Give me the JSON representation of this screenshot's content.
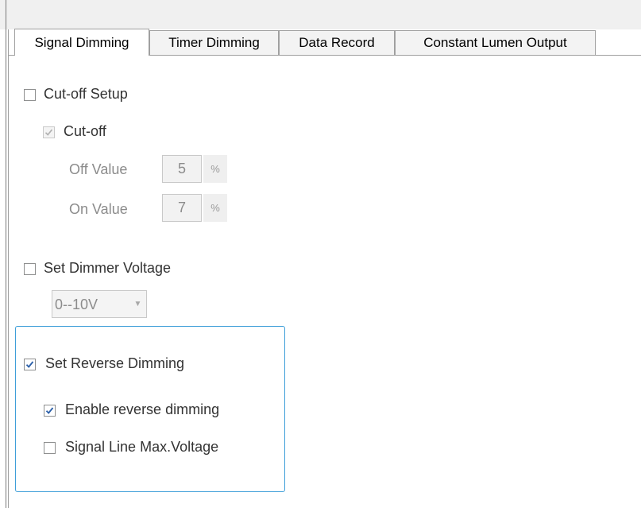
{
  "tabs": [
    {
      "label": "Signal Dimming",
      "active": true
    },
    {
      "label": "Timer Dimming",
      "active": false
    },
    {
      "label": "Data Record",
      "active": false
    },
    {
      "label": "Constant Lumen Output",
      "active": false
    }
  ],
  "cutoff_setup": {
    "label": "Cut-off Setup",
    "checked": false
  },
  "cutoff": {
    "label": "Cut-off",
    "checked": true,
    "enabled": false
  },
  "off_value": {
    "label": "Off Value",
    "value": "5",
    "unit": "%"
  },
  "on_value": {
    "label": "On Value",
    "value": "7",
    "unit": "%"
  },
  "dimmer_voltage": {
    "label": "Set Dimmer Voltage",
    "checked": false,
    "selected": "0--10V"
  },
  "reverse_dimming": {
    "label": "Set Reverse Dimming",
    "checked": true
  },
  "enable_reverse": {
    "label": "Enable reverse dimming",
    "checked": true
  },
  "signal_line": {
    "label": "Signal Line Max.Voltage",
    "checked": false
  },
  "colors": {
    "accent": "#3f9fd9",
    "check": "#2a5ea8",
    "disabled_check": "#b0b0b0"
  }
}
